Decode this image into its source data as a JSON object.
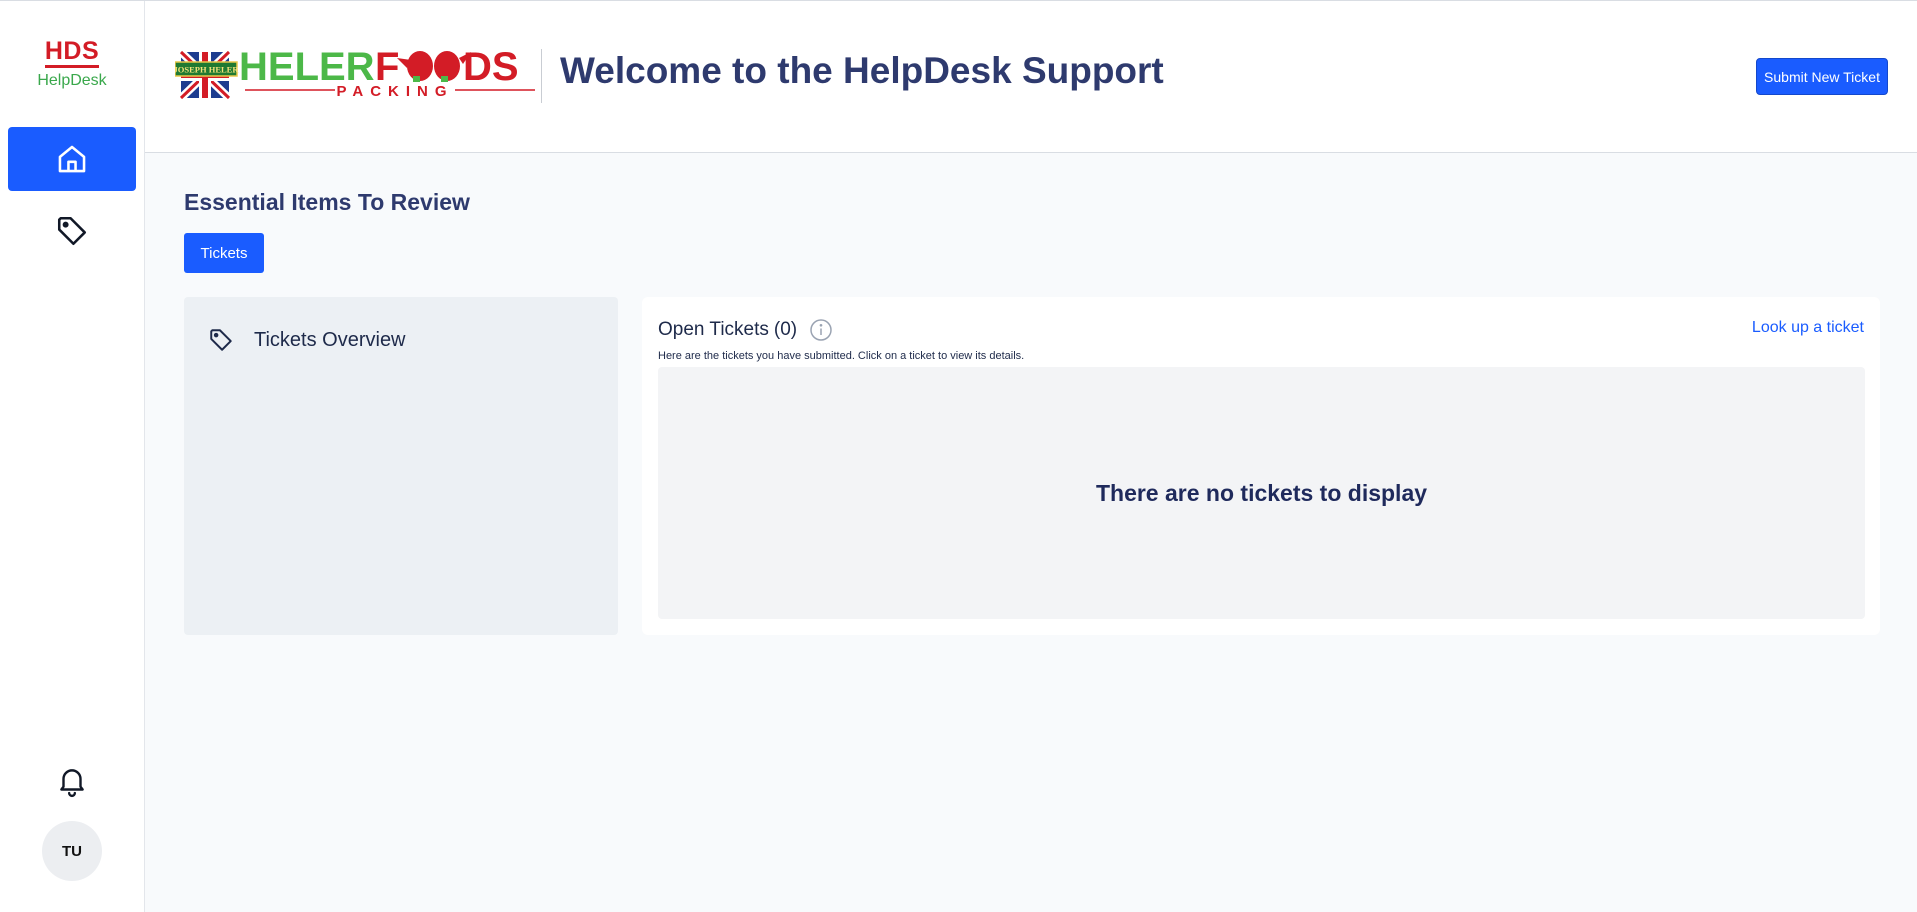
{
  "brand": {
    "code": "HDS",
    "name": "HelpDesk"
  },
  "logo": {
    "badge_text": "JOSEPH HELER",
    "word_heler": "HELER",
    "word_foods_f": "F",
    "word_foods_ds": "DS",
    "subtitle": "PACKING"
  },
  "header": {
    "title": "Welcome to the HelpDesk Support",
    "submit_button": "Submit New Ticket"
  },
  "sidebar": {
    "items": [
      {
        "icon": "home-icon",
        "active": true
      },
      {
        "icon": "tag-icon",
        "active": false
      }
    ],
    "bell_icon": "bell-icon",
    "avatar_initials": "TU"
  },
  "main": {
    "section_title": "Essential Items To Review",
    "tabs": [
      {
        "label": "Tickets",
        "active": true
      }
    ],
    "overview": {
      "label": "Tickets Overview",
      "icon": "tag-icon"
    },
    "open_tickets": {
      "title": "Open Tickets",
      "count": "(0)",
      "description": "Here are the tickets you have submitted. Click on a ticket to view its details.",
      "lookup_link": "Look up a ticket",
      "empty_message": "There are no tickets to display"
    }
  },
  "colors": {
    "accent": "#1a5cff",
    "brand_red": "#d31c26",
    "brand_green": "#3aa84c",
    "title_navy": "#2e3a6e"
  }
}
